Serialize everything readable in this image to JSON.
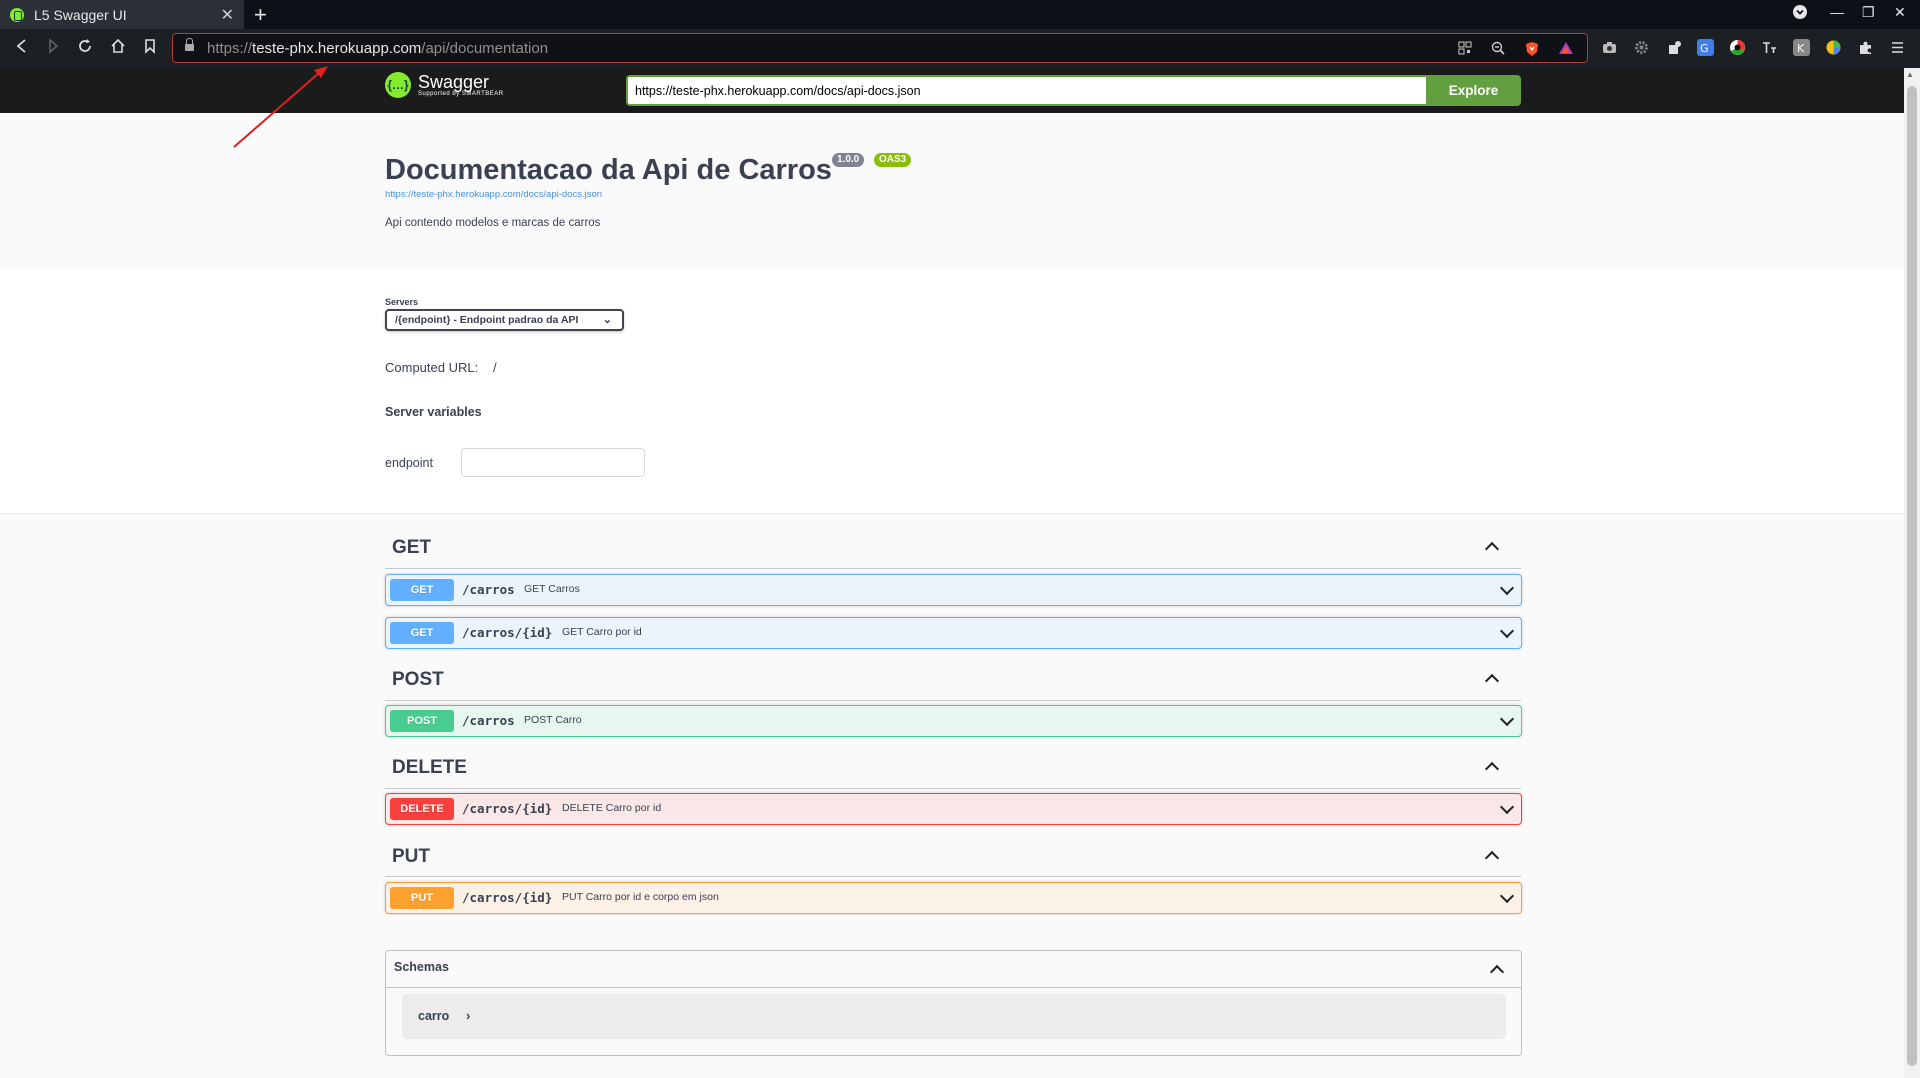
{
  "browser": {
    "tab_title": "L5 Swagger UI",
    "tab_close": "✕",
    "new_tab": "+",
    "url_prefix": "https://",
    "url_host": "teste-phx.herokuapp.com",
    "url_path": "/api/documentation",
    "window_controls": {
      "minimize": "—",
      "maximize": "❐",
      "close": "✕"
    }
  },
  "topbar": {
    "logo_text": "Swagger",
    "logo_sub": "Supported by SMARTBEAR",
    "spec_url": "https://teste-phx.herokuapp.com/docs/api-docs.json",
    "explore_label": "Explore"
  },
  "info": {
    "title": "Documentacao da Api de Carros",
    "version": "1.0.0",
    "oas": "OAS3",
    "spec_link": "https://teste-phx.herokuapp.com/docs/api-docs.json",
    "description": "Api contendo modelos e marcas de carros"
  },
  "servers": {
    "label": "Servers",
    "selected": "/{endpoint} - Endpoint padrao da API",
    "computed_label": "Computed URL:",
    "computed_value": "/",
    "variables_title": "Server variables",
    "variable_name": "endpoint",
    "variable_value": ""
  },
  "tags": [
    {
      "name": "GET",
      "operations": [
        {
          "method": "GET",
          "path": "/carros",
          "summary": "GET Carros"
        },
        {
          "method": "GET",
          "path": "/carros/{id}",
          "summary": "GET Carro por id"
        }
      ]
    },
    {
      "name": "POST",
      "operations": [
        {
          "method": "POST",
          "path": "/carros",
          "summary": "POST Carro"
        }
      ]
    },
    {
      "name": "DELETE",
      "operations": [
        {
          "method": "DELETE",
          "path": "/carros/{id}",
          "summary": "DELETE Carro por id"
        }
      ]
    },
    {
      "name": "PUT",
      "operations": [
        {
          "method": "PUT",
          "path": "/carros/{id}",
          "summary": "PUT Carro por id e corpo em json"
        }
      ]
    }
  ],
  "schemas": {
    "title": "Schemas",
    "models": [
      "carro"
    ]
  },
  "colors": {
    "get": "#61affe",
    "post": "#49cc90",
    "delete": "#f93e3e",
    "put": "#fca130",
    "explore": "#62a03f",
    "swagger_green": "#85ea2d"
  },
  "icons": {
    "back": "back-arrow-icon",
    "forward": "forward-arrow-icon",
    "reload": "reload-icon",
    "home": "home-icon",
    "bookmark": "bookmark-icon",
    "lock": "lock-icon",
    "qr": "qr-code-icon",
    "zoom": "zoom-out-icon",
    "brave": "brave-shield-icon",
    "rewards": "brave-rewards-icon",
    "extensions": [
      "camera-icon",
      "gear-icon",
      "puzzle-extension-icon",
      "translate-icon",
      "chrome-icon",
      "text-icon",
      "extension-k-icon",
      "color-wheel-icon",
      "puzzle-icon",
      "menu-icon"
    ]
  }
}
